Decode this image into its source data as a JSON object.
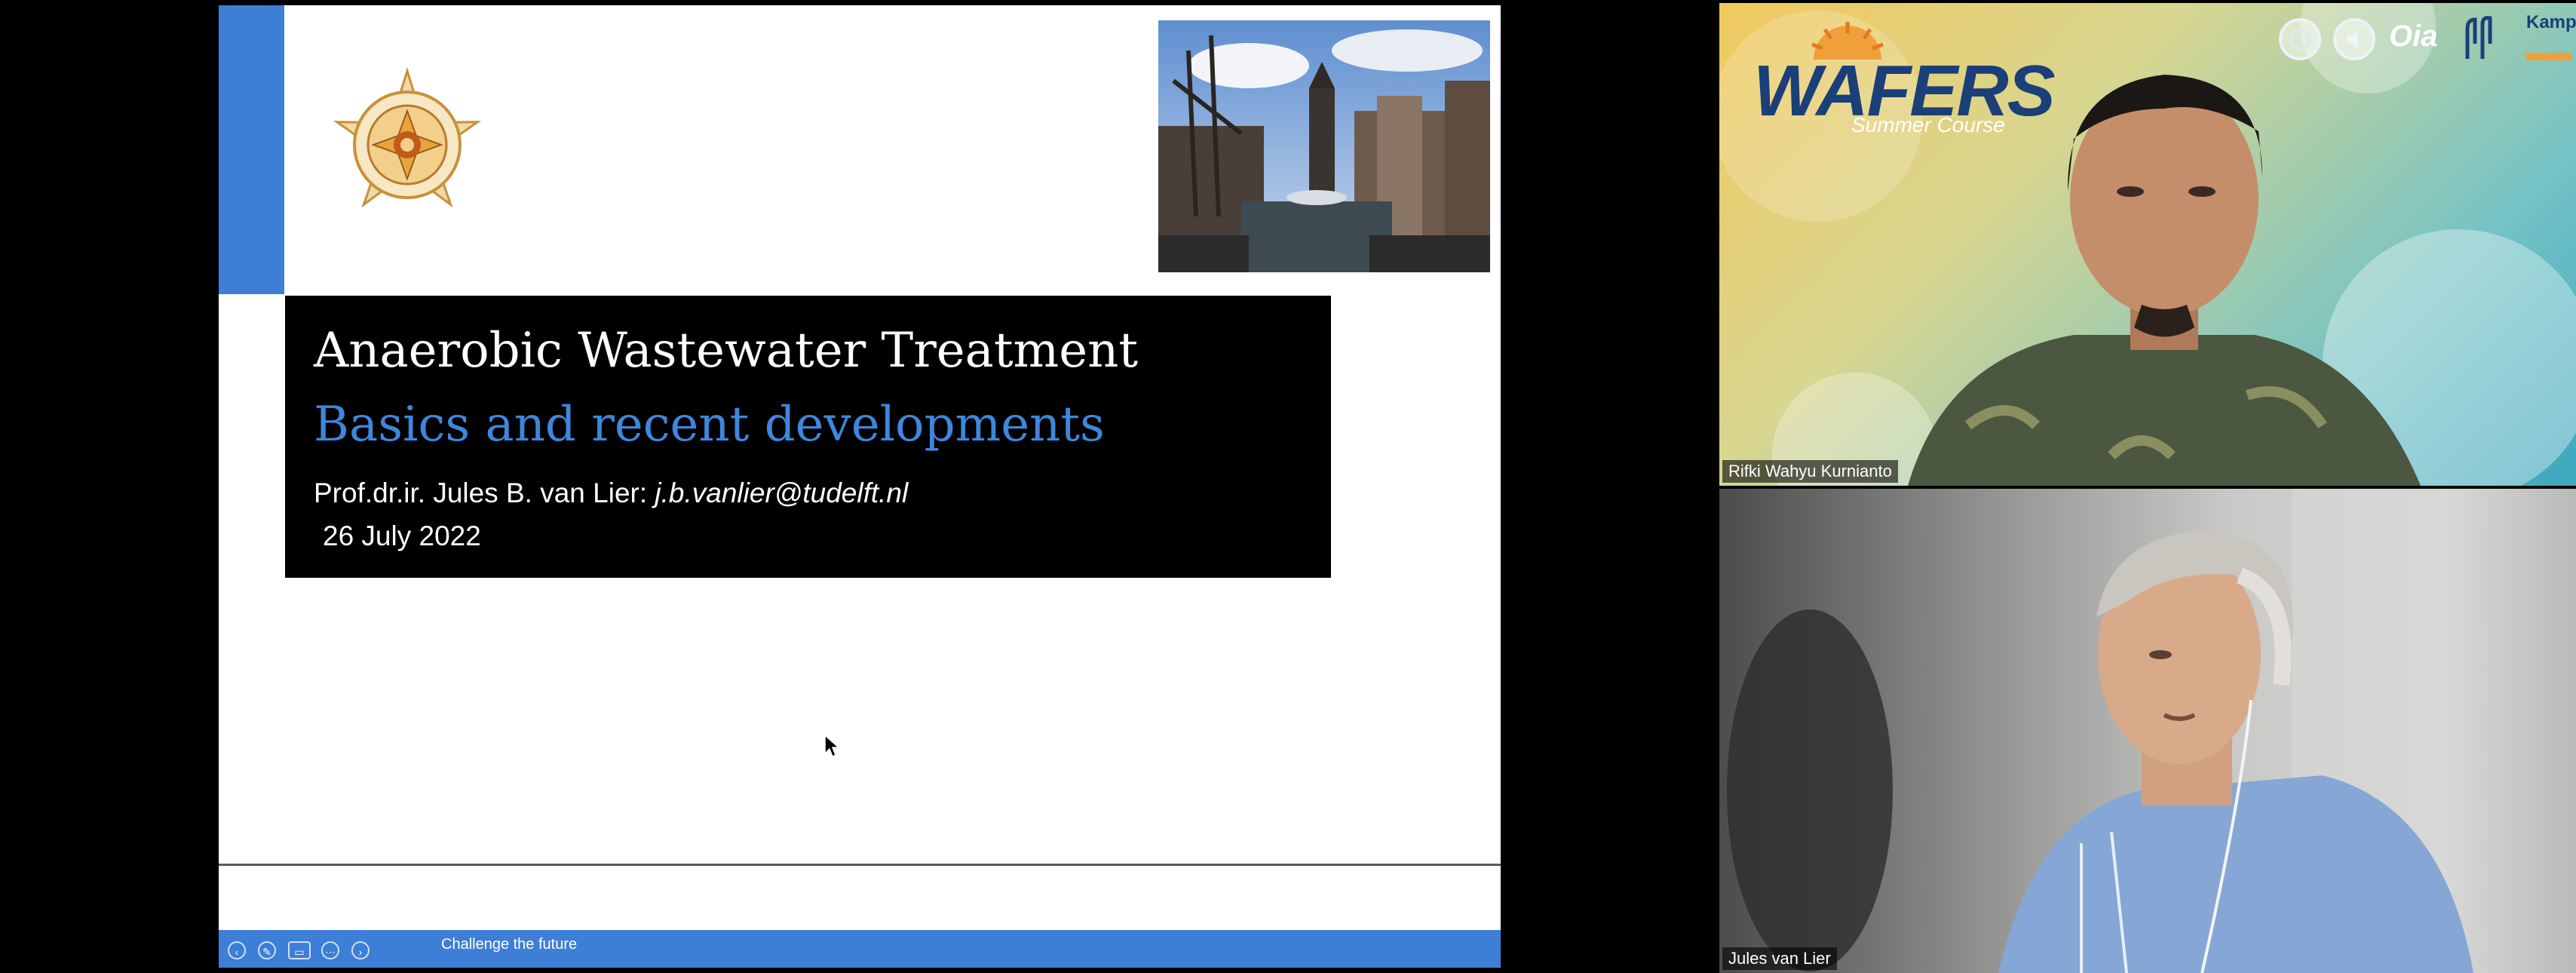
{
  "slide": {
    "title": "Anaerobic Wastewater Treatment",
    "subtitle": "Basics and recent developments",
    "author_prefix": "Prof.dr.ir. Jules B. van Lier:",
    "author_email": "j.b.vanlier@tudelft.nl",
    "date": "26 July 2022",
    "footer_text": "Challenge the future",
    "nav_controls": [
      "previous-icon",
      "pen-icon",
      "subtitles-icon",
      "more-icon",
      "next-icon"
    ],
    "accent_color": "#3d7ed6"
  },
  "participants": [
    {
      "name": "Rifki Wahyu Kurnianto",
      "background_brand": "WAFERS",
      "background_tagline": "Summer Course",
      "partner_text": "Kampus Merdeka",
      "partner_badge": "Oia"
    },
    {
      "name": "Jules van Lier"
    }
  ]
}
